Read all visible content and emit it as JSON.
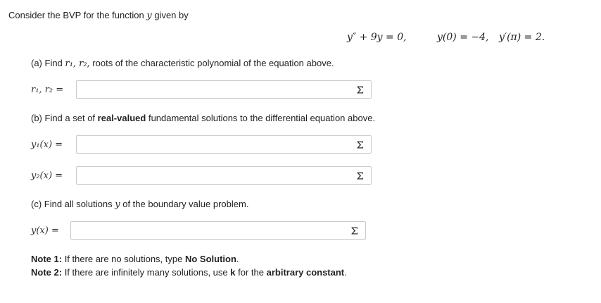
{
  "intro": "Consider the BVP for the function",
  "intro_var": "y",
  "intro_tail": "given by",
  "ode": "y″ + 9y = 0,",
  "bc1": "y(0) = −4,",
  "bc2": "y′(π) = 2.",
  "part_a": {
    "text_pre": "(a) Find",
    "vars": "r₁, r₂,",
    "text_post": "roots of the characteristic polynomial of the equation above.",
    "field_label": "r₁, r₂ =",
    "value": ""
  },
  "part_b": {
    "text_pre": "(b) Find a set of",
    "bold": "real-valued",
    "text_post": "fundamental solutions to the differential equation above.",
    "y1_label": "y₁(x) =",
    "y1_value": "",
    "y2_label": "y₂(x) =",
    "y2_value": ""
  },
  "part_c": {
    "text_pre": "(c) Find all solutions",
    "var": "y",
    "text_post": "of the boundary value problem.",
    "field_label": "y(x) =",
    "value": ""
  },
  "note1": {
    "label": "Note 1:",
    "text": "If there are no solutions, type",
    "bold": "No Solution",
    "end": "."
  },
  "note2": {
    "label": "Note 2:",
    "text": "If there are infinitely many solutions, use",
    "bold_k": "k",
    "mid": "for the",
    "bold_end": "arbitrary constant",
    "end": "."
  },
  "icons": {
    "equation_editor": "sigma-icon"
  }
}
